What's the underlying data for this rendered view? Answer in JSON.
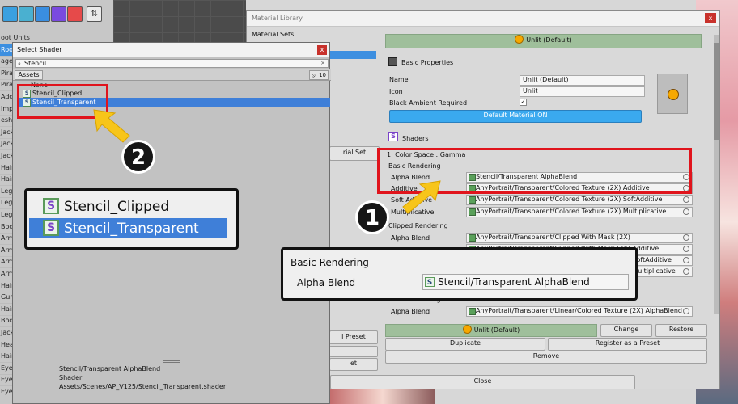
{
  "background": {
    "tree_items": [
      "oot Units",
      "Roo",
      "ages",
      "Pira",
      "Pira",
      "Add",
      "Impe",
      "eshe",
      "Jack",
      "Jack",
      "Jack",
      "Hair",
      "Hair",
      "Leg",
      "Leg",
      "Leg",
      "Bod",
      "Arm",
      "Arm",
      "Arm",
      "Arm",
      "Hair",
      "Gun",
      "Hair",
      "Bod",
      "Jack",
      "Head",
      "Hair",
      "Eye",
      "Eye",
      "Eye"
    ]
  },
  "material_library": {
    "title": "Material Library",
    "material_sets_label": "Material Sets",
    "header": "Unlit (Default)",
    "basic_properties_label": "Basic Properties",
    "name_label": "Name",
    "name_value": "Unlit (Default)",
    "icon_label": "Icon",
    "icon_value": "Unlit",
    "black_ambient_label": "Black Ambient Required",
    "default_material_btn": "Default Material ON",
    "shaders_label": "Shaders",
    "color_space": "1. Color Space : Gamma",
    "basic_rendering": "Basic Rendering",
    "rows": [
      {
        "label": "Alpha Blend",
        "value": "Stencil/Transparent AlphaBlend"
      },
      {
        "label": "Additive",
        "value": "AnyPortrait/Transparent/Colored Texture (2X) Additive"
      },
      {
        "label": "Soft Additive",
        "value": "AnyPortrait/Transparent/Colored Texture (2X) SoftAdditive"
      },
      {
        "label": "Multiplicative",
        "value": "AnyPortrait/Transparent/Colored Texture (2X) Multiplicative"
      }
    ],
    "clipped_rendering": "Clipped Rendering",
    "clipped_rows": [
      {
        "label": "Alpha Blend",
        "value": "AnyPortrait/Transparent/Clipped With Mask (2X)"
      },
      {
        "label": "",
        "value": "AnyPortrait/Transparent/Clipped With Mask (2X) Additive"
      },
      {
        "label": "",
        "value": "AnyPortrait/Transparent/Clipped With Mask (2X) SoftAdditive"
      },
      {
        "label": "",
        "value": "AnyPortrait/Transparent/Clipped With Mask (2X) Multiplicative"
      }
    ],
    "linear_rendering": "Basic Rendering",
    "linear_row": {
      "label": "Alpha Blend",
      "value": "AnyPortrait/Transparent/Linear/Colored Texture (2X) AlphaBlend"
    },
    "bottom_preset": "Unlit (Default)",
    "change_btn": "Change",
    "restore_btn": "Restore",
    "duplicate_btn": "Duplicate",
    "register_btn": "Register as a Preset",
    "remove_btn": "Remove",
    "close_btn": "Close",
    "side_set_btn": "rial Set",
    "side_preset_btn": "l Preset",
    "side_btn3": "et"
  },
  "select_shader": {
    "title": "Select Shader",
    "search_value": "Stencil",
    "tab_assets": "Assets",
    "count": "10",
    "items": [
      "None",
      "Stencil_Clipped",
      "Stencil_Transparent"
    ],
    "footer_name": "Stencil/Transparent AlphaBlend",
    "footer_type": "Shader",
    "footer_path": "Assets/Scenes/AP_V125/Stencil_Transparent.shader"
  },
  "callout_left": {
    "items": [
      "Stencil_Clipped",
      "Stencil_Transparent"
    ]
  },
  "callout_right": {
    "heading": "Basic Rendering",
    "label": "Alpha Blend",
    "value": "Stencil/Transparent AlphaBlend"
  },
  "badges": {
    "one": "1",
    "two": "2"
  },
  "colors": {
    "accent": "#3d8fe0",
    "selection": "#3f7fd8",
    "red": "#e0141c",
    "green_header": "#9fbf9b",
    "arrow": "#f7c51a"
  }
}
